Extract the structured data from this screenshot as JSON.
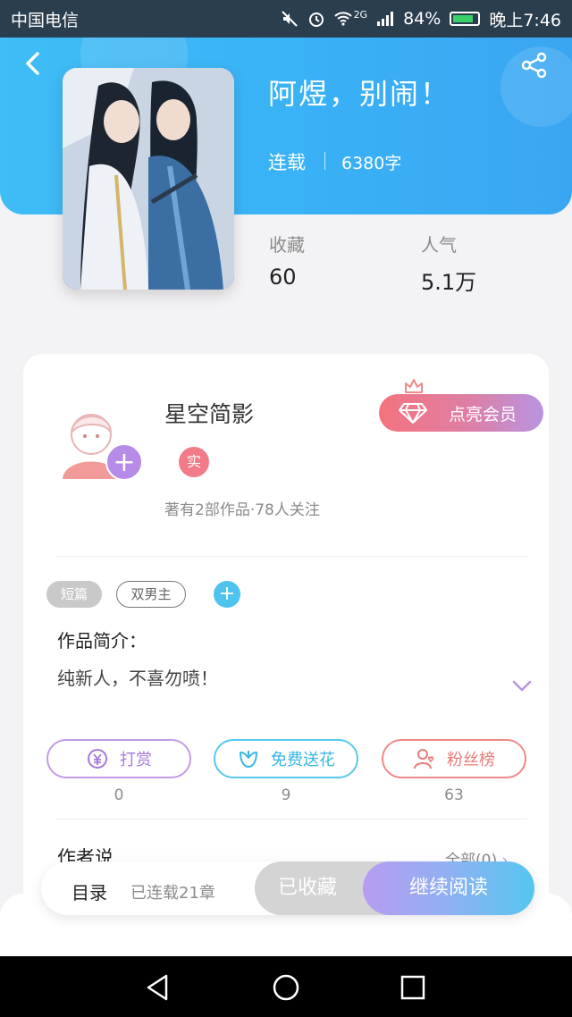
{
  "statusbar": {
    "carrier": "中国电信",
    "network": "2G",
    "battery": "84%",
    "time": "晚上7:46"
  },
  "book": {
    "title": "阿煜，别闹！",
    "status": "连载",
    "word_count": "6380字",
    "stats": [
      {
        "label": "收藏",
        "value": "60"
      },
      {
        "label": "人气",
        "value": "5.1万"
      }
    ]
  },
  "author": {
    "name": "星空简影",
    "badge": "实",
    "meta": "著有2部作品·78人关注",
    "vip_button": "点亮会员"
  },
  "tags": {
    "short": "短篇",
    "genre": "双男主",
    "add": "+"
  },
  "intro": {
    "title": "作品简介：",
    "text": "纯新人，不喜勿喷！"
  },
  "actions": [
    {
      "label": "打赏",
      "count": "0",
      "icon": "coin-icon"
    },
    {
      "label": "免费送花",
      "count": "9",
      "icon": "flower-icon"
    },
    {
      "label": "粉丝榜",
      "count": "63",
      "icon": "fan-icon"
    }
  ],
  "author_say": {
    "title": "作者说",
    "all_link": "全部(0)"
  },
  "bottom_bar": {
    "catalog": "目录",
    "chapters": "已连载21章",
    "collected": "已收藏",
    "continue": "继续阅读"
  },
  "colors": {
    "header": "#3ab5f6",
    "vip": "#f4737e",
    "read_button": "#55c6ef"
  }
}
